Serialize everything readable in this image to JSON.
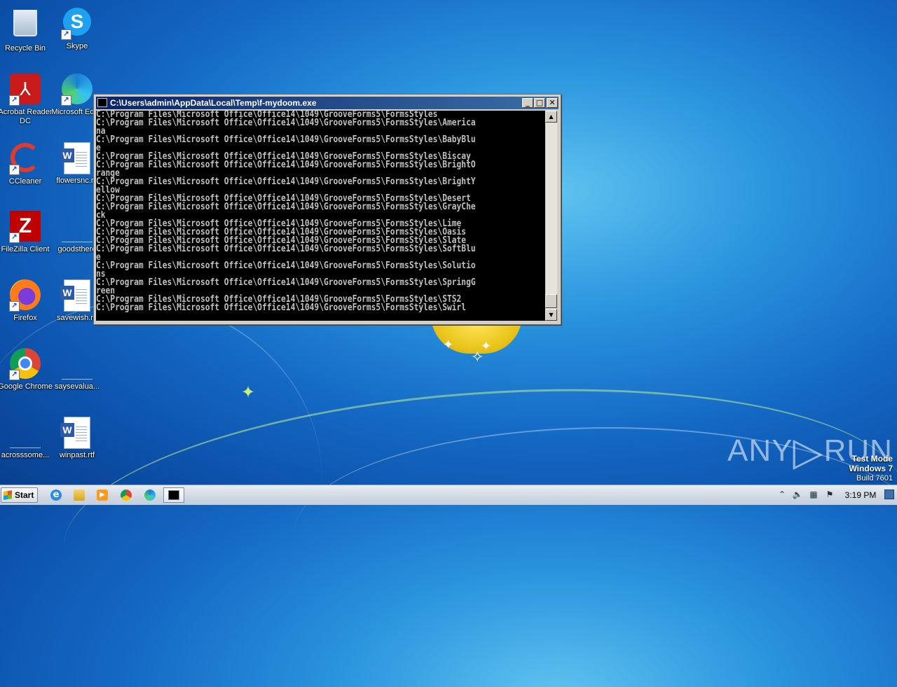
{
  "desktop": {
    "icons": [
      {
        "label": "Recycle Bin"
      },
      {
        "label": "Skype"
      },
      {
        "label": "Acrobat Reader DC"
      },
      {
        "label": "Microsoft Edge"
      },
      {
        "label": "CCleaner"
      },
      {
        "label": "flowersnc.rtf"
      },
      {
        "label": "FileZilla Client"
      },
      {
        "label": "goodsthere"
      },
      {
        "label": "Firefox"
      },
      {
        "label": "savewish.rtf"
      },
      {
        "label": "Google Chrome"
      },
      {
        "label": "saysevalua..."
      },
      {
        "label": "acrosssome..."
      },
      {
        "label": "winpast.rtf"
      }
    ]
  },
  "console_window": {
    "title": "C:\\Users\\admin\\AppData\\Local\\Temp\\f-mydoom.exe",
    "lines": [
      "C:\\Program Files\\Microsoft Office\\Office14\\1049\\GrooveForms5\\FormsStyles",
      "C:\\Program Files\\Microsoft Office\\Office14\\1049\\GrooveForms5\\FormsStyles\\America",
      "na",
      "C:\\Program Files\\Microsoft Office\\Office14\\1049\\GrooveForms5\\FormsStyles\\BabyBlu",
      "e",
      "C:\\Program Files\\Microsoft Office\\Office14\\1049\\GrooveForms5\\FormsStyles\\Biscay",
      "C:\\Program Files\\Microsoft Office\\Office14\\1049\\GrooveForms5\\FormsStyles\\BrightO",
      "range",
      "C:\\Program Files\\Microsoft Office\\Office14\\1049\\GrooveForms5\\FormsStyles\\BrightY",
      "ellow",
      "C:\\Program Files\\Microsoft Office\\Office14\\1049\\GrooveForms5\\FormsStyles\\Desert",
      "C:\\Program Files\\Microsoft Office\\Office14\\1049\\GrooveForms5\\FormsStyles\\GrayChe",
      "ck",
      "C:\\Program Files\\Microsoft Office\\Office14\\1049\\GrooveForms5\\FormsStyles\\Lime",
      "C:\\Program Files\\Microsoft Office\\Office14\\1049\\GrooveForms5\\FormsStyles\\Oasis",
      "C:\\Program Files\\Microsoft Office\\Office14\\1049\\GrooveForms5\\FormsStyles\\Slate",
      "C:\\Program Files\\Microsoft Office\\Office14\\1049\\GrooveForms5\\FormsStyles\\SoftBlu",
      "e",
      "C:\\Program Files\\Microsoft Office\\Office14\\1049\\GrooveForms5\\FormsStyles\\Solutio",
      "ns",
      "C:\\Program Files\\Microsoft Office\\Office14\\1049\\GrooveForms5\\FormsStyles\\SpringG",
      "reen",
      "C:\\Program Files\\Microsoft Office\\Office14\\1049\\GrooveForms5\\FormsStyles\\STS2",
      "C:\\Program Files\\Microsoft Office\\Office14\\1049\\GrooveForms5\\FormsStyles\\Swirl"
    ],
    "buttons": {
      "minimize": "_",
      "maximize": "□",
      "close": "✕"
    },
    "scroll_up": "▲",
    "scroll_down": "▼"
  },
  "watermark": {
    "brand_left": "ANY",
    "brand_right": "RUN",
    "line1": "Test Mode",
    "line2": "Windows 7",
    "line3": "Build 7601"
  },
  "taskbar": {
    "start_label": "Start",
    "clock": "3:19 PM",
    "apps": [
      "internet-explorer-icon",
      "file-explorer-icon",
      "media-player-icon",
      "chrome-icon",
      "edge-icon",
      "console-icon"
    ],
    "tray": [
      "show-hidden-icons",
      "volume-icon",
      "network-icon",
      "action-center-flag-icon"
    ]
  },
  "colors": {
    "console_bg": "#000000",
    "console_text": "#c0c0c0",
    "titlebar_start": "#0a246a",
    "titlebar_end": "#3a6ea5"
  }
}
